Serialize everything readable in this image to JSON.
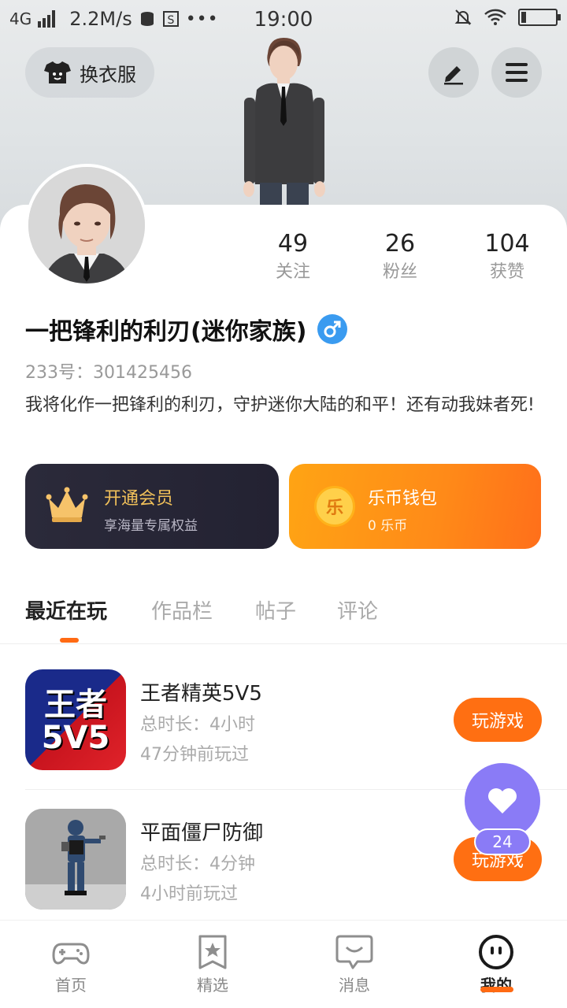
{
  "status_bar": {
    "network": "4G",
    "speed": "2.2M/s",
    "time": "19:00",
    "icons": [
      "signal-icon",
      "data-icon",
      "s-app-icon",
      "more-dots-icon",
      "mute-icon",
      "wifi-icon",
      "battery-icon"
    ]
  },
  "header": {
    "outfit_label": "换衣服",
    "edit_icon": "edit-icon",
    "menu_icon": "menu-icon"
  },
  "profile": {
    "stats": [
      {
        "value": "49",
        "label": "关注"
      },
      {
        "value": "26",
        "label": "粉丝"
      },
      {
        "value": "104",
        "label": "获赞"
      }
    ],
    "name": "一把锋利的利刃(迷你家族)",
    "gender_icon": "male-icon",
    "uid_label": "233号：",
    "uid": "301425456",
    "bio": "我将化作一把锋利的利刃，守护迷你大陆的和平！还有动我妹者死!"
  },
  "cards": {
    "vip": {
      "title": "开通会员",
      "subtitle": "享海量专属权益",
      "icon": "crown-icon",
      "accent": "#f2c15a"
    },
    "wallet": {
      "title": "乐币钱包",
      "subtitle": "0 乐币",
      "icon": "coin-icon",
      "coin_char": "乐"
    }
  },
  "tabs": [
    {
      "label": "最近在玩",
      "active": true
    },
    {
      "label": "作品栏",
      "active": false
    },
    {
      "label": "帖子",
      "active": false
    },
    {
      "label": "评论",
      "active": false
    }
  ],
  "games": [
    {
      "title": "王者精英5V5",
      "duration": "总时长：4小时",
      "last_played": "47分钟前玩过",
      "button": "玩游戏",
      "icon_text_top": "王者",
      "icon_text_bottom": "5V5"
    },
    {
      "title": "平面僵尸防御",
      "duration": "总时长：4分钟",
      "last_played": "4小时前玩过",
      "button": "玩游戏"
    }
  ],
  "fab": {
    "icon": "heart-icon",
    "count": "24"
  },
  "nav": [
    {
      "label": "首页",
      "icon": "gamepad-icon",
      "active": false
    },
    {
      "label": "精选",
      "icon": "star-badge-icon",
      "active": false
    },
    {
      "label": "消息",
      "icon": "chat-icon",
      "active": false
    },
    {
      "label": "我的",
      "icon": "smile-face-icon",
      "active": true
    }
  ],
  "colors": {
    "accent": "#ff6f12",
    "fab": "#8a7bf6",
    "gender": "#3a9bf0"
  }
}
